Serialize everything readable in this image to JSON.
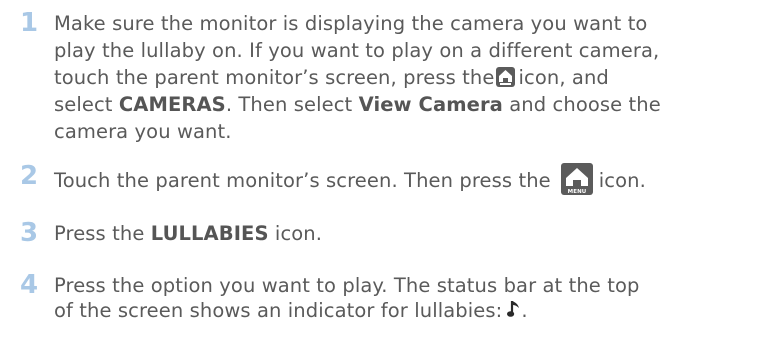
{
  "steps": [
    {
      "number": "1",
      "l1": "Make sure the monitor is displaying the camera you want to",
      "l2": "play the lullaby on. If you want to play on a different camera,",
      "l3a": "touch the parent monitor’s screen, press the",
      "l3b": "icon, and",
      "l4a": "select ",
      "l4b": "CAMERAS",
      "l4c": ". Then select ",
      "l4d": "View Camera",
      "l4e": " and choose the",
      "l5": "camera you want.",
      "icon": "home-menu-icon"
    },
    {
      "number": "2",
      "l1a": "Touch the parent monitor’s screen. Then press the",
      "l1b": "icon.",
      "icon": "home-menu-icon",
      "icon_caption": "MENU"
    },
    {
      "number": "3",
      "l1a": "Press the ",
      "l1b": "LULLABIES",
      "l1c": " icon."
    },
    {
      "number": "4",
      "l1": "Press the option you want to play. The status bar at the top",
      "l2": "of the screen shows an indicator for lullabies:",
      "l2end": ".",
      "icon": "music-note-icon"
    }
  ],
  "colors": {
    "step_number": "#a9c8e6",
    "text": "#5a5a5a",
    "icon_bg": "#5b5b5b"
  }
}
